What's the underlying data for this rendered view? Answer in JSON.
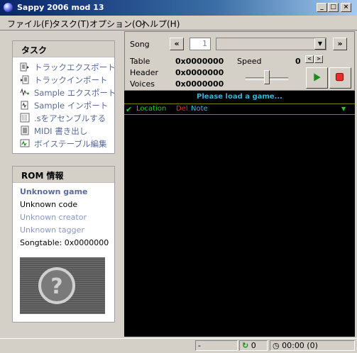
{
  "window": {
    "title": "Sappy 2006 mod 13"
  },
  "menu": {
    "items": [
      "ファイル(F)",
      "タスク(T)",
      "オプション(O)",
      "ヘルプ(H)"
    ]
  },
  "tasks": {
    "header": "タスク",
    "items": [
      {
        "label": "トラックエクスポート",
        "icon": "track-export-icon"
      },
      {
        "label": "トラックインポート",
        "icon": "track-import-icon"
      },
      {
        "label": "Sample エクスポート",
        "icon": "sample-export-icon"
      },
      {
        "label": "Sample インポート",
        "icon": "sample-import-icon"
      },
      {
        "label": ".sをアセンブルする",
        "icon": "assemble-icon"
      },
      {
        "label": "MIDI 書き出し",
        "icon": "midi-export-icon"
      },
      {
        "label": "ボイステーブル編集",
        "icon": "voice-table-icon"
      }
    ]
  },
  "rom": {
    "header": "ROM 情報",
    "game": "Unknown game",
    "code": "Unknown code",
    "creator": "Unknown creator",
    "tagger": "Unknown tagger",
    "songtable": "Songtable: 0x0000000"
  },
  "song": {
    "label": "Song",
    "prev": "«",
    "next": "»",
    "number": "1",
    "table_label": "Table",
    "table_value": "0x0000000",
    "header_label": "Header",
    "header_value": "0x0000000",
    "voices_label": "Voices",
    "voices_value": "0x0000000",
    "speed_label": "Speed",
    "speed_value": "0",
    "speed_down": "<",
    "speed_up": ">"
  },
  "message": "Please load a game...",
  "columns": {
    "location": "Location",
    "del": "Del",
    "note": "Note"
  },
  "status": {
    "cell1": "-",
    "loops": "0",
    "time": "00:00 (0)"
  },
  "colors": {
    "accent_location": "#22cc22",
    "accent_del": "#e03030",
    "accent_note": "#30c0e0",
    "message": "#3ab0d8"
  }
}
